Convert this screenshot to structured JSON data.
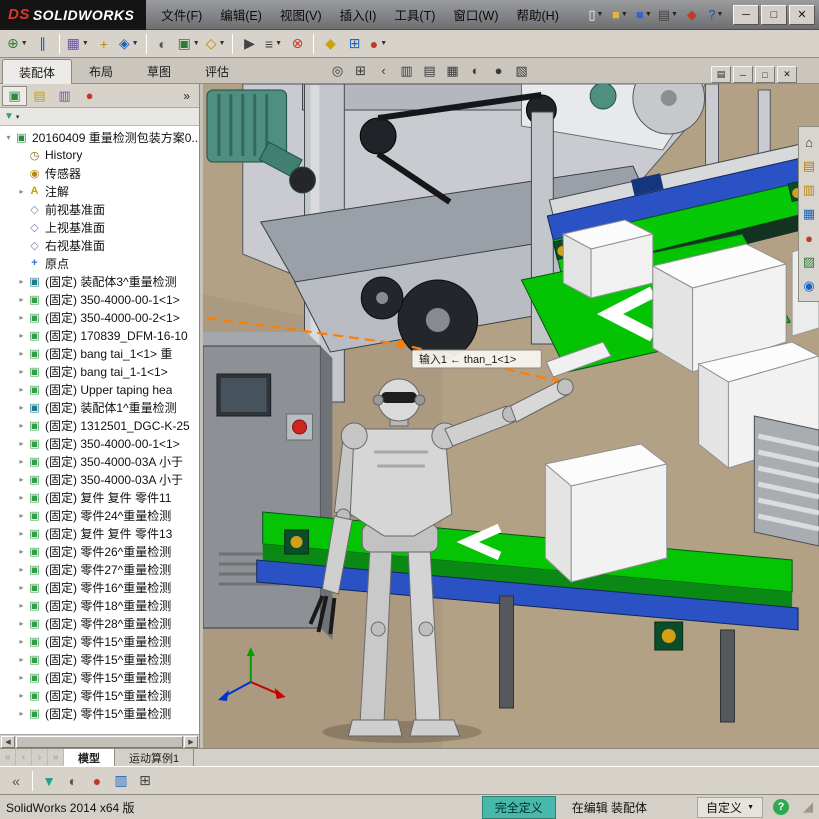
{
  "titlebar": {
    "logo_prefix": "DS",
    "logo": "SOLIDWORKS",
    "menus": [
      {
        "name": "menu-file",
        "label": "文件(F)"
      },
      {
        "name": "menu-edit",
        "label": "编辑(E)"
      },
      {
        "name": "menu-view",
        "label": "视图(V)"
      },
      {
        "name": "menu-insert",
        "label": "插入(I)"
      },
      {
        "name": "menu-tools",
        "label": "工具(T)"
      },
      {
        "name": "menu-window",
        "label": "窗口(W)"
      },
      {
        "name": "menu-help",
        "label": "帮助(H)"
      }
    ],
    "quick_icons": [
      {
        "name": "new-document-icon",
        "glyph": "▯",
        "color": "#f5f5f5",
        "caret": true
      },
      {
        "name": "open-document-icon",
        "glyph": "■",
        "color": "#e6b33c",
        "caret": true
      },
      {
        "name": "save-icon",
        "glyph": "■",
        "color": "#3a63c8",
        "caret": true
      },
      {
        "name": "print-icon",
        "glyph": "▤",
        "color": "#444444",
        "caret": true
      },
      {
        "name": "solidworks-cube-icon",
        "glyph": "◆",
        "color": "#c0392b",
        "caret": false
      },
      {
        "name": "help-icon",
        "glyph": "?",
        "color": "#1b4fa0",
        "caret": true
      }
    ],
    "window_controls": [
      {
        "name": "minimize-button",
        "glyph": "─"
      },
      {
        "name": "maximize-button",
        "glyph": "□"
      },
      {
        "name": "close-button",
        "glyph": "✕"
      }
    ]
  },
  "toolbar": {
    "icons": [
      {
        "name": "insert-components-button",
        "glyph": "⊕",
        "color": "#2e7d32",
        "caret": true
      },
      {
        "name": "mate-button",
        "glyph": "∥",
        "color": "#1565c0",
        "caret": false
      },
      {
        "name": "linear-component-pattern-button",
        "glyph": "▦",
        "color": "#6a4fa0",
        "caret": true,
        "sep": true
      },
      {
        "name": "smart-fasteners-button",
        "glyph": "+",
        "color": "#c28b00",
        "caret": false
      },
      {
        "name": "move-component-button",
        "glyph": "◈",
        "color": "#1565c0",
        "caret": true
      },
      {
        "name": "show-hidden-components-button",
        "glyph": "◐",
        "color": "#555555",
        "caret": false,
        "sep": true
      },
      {
        "name": "assembly-features-button",
        "glyph": "▣",
        "color": "#2e7d32",
        "caret": true
      },
      {
        "name": "reference-geometry-button",
        "glyph": "◇",
        "color": "#b8860b",
        "caret": true
      },
      {
        "name": "new-motion-study-button",
        "glyph": "▶",
        "color": "#444444",
        "caret": false,
        "sep": true
      },
      {
        "name": "bill-of-materials-button",
        "glyph": "≡",
        "color": "#444444",
        "caret": true
      },
      {
        "name": "exploded-view-button",
        "glyph": "⊗",
        "color": "#c0392b",
        "caret": false
      },
      {
        "name": "instant3d-button",
        "glyph": "◆",
        "color": "#caa500",
        "caret": false,
        "sep": true
      },
      {
        "name": "interference-detection-button",
        "glyph": "⊞",
        "color": "#1565c0",
        "caret": false
      },
      {
        "name": "edit-appearance-button",
        "glyph": "●",
        "color": "#c0392b",
        "caret": true
      }
    ]
  },
  "command_tabs": {
    "tabs": [
      {
        "name": "tab-assembly",
        "label": "装配体",
        "active": true
      },
      {
        "name": "tab-layout",
        "label": "布局",
        "active": false
      },
      {
        "name": "tab-sketch",
        "label": "草图",
        "active": false
      },
      {
        "name": "tab-evaluate",
        "label": "评估",
        "active": false
      }
    ]
  },
  "headsup": {
    "icons": [
      {
        "name": "zoom-fit-icon",
        "glyph": "◎"
      },
      {
        "name": "zoom-area-icon",
        "glyph": "⊞"
      },
      {
        "name": "previous-view-icon",
        "glyph": "‹"
      },
      {
        "name": "section-view-icon",
        "glyph": "▥"
      },
      {
        "name": "view-orientation-icon",
        "glyph": "▤"
      },
      {
        "name": "display-style-icon",
        "glyph": "▦"
      },
      {
        "name": "hide-show-items-icon",
        "glyph": "◐"
      },
      {
        "name": "edit-appearance-icon",
        "glyph": "●"
      },
      {
        "name": "apply-scene-icon",
        "glyph": "▧"
      }
    ],
    "doc_controls": [
      {
        "name": "doc-menu-icon",
        "glyph": "▤"
      },
      {
        "name": "doc-minimize-button",
        "glyph": "─"
      },
      {
        "name": "doc-restore-button",
        "glyph": "□"
      },
      {
        "name": "doc-close-button",
        "glyph": "✕"
      }
    ]
  },
  "panel": {
    "manager_tabs": [
      {
        "name": "featuremanager-tab",
        "glyph": "▣",
        "color": "#2b8a3e",
        "active": true
      },
      {
        "name": "propertymanager-tab",
        "glyph": "▤",
        "color": "#c9a200",
        "active": false
      },
      {
        "name": "configurationmanager-tab",
        "glyph": "▥",
        "color": "#7a4fa0",
        "active": false
      },
      {
        "name": "displaymanager-tab",
        "glyph": "●",
        "color": "#c0392b",
        "active": false
      }
    ],
    "overflow": "»",
    "filter": {
      "glyph": "▼",
      "color": "#2b9e8f"
    },
    "tree_icons": {
      "assembly": {
        "glyph": "▣",
        "color": "#2b8a3e"
      },
      "history": {
        "glyph": "◷",
        "color": "#8a6d1a"
      },
      "sensors": {
        "glyph": "◉",
        "color": "#b8860b"
      },
      "annotations": {
        "glyph": "A",
        "color": "#c9a200"
      },
      "plane": {
        "glyph": "◇",
        "color": "#6f87a8"
      },
      "origin": {
        "glyph": "+",
        "color": "#2f6fd0"
      },
      "component": {
        "glyph": "▣",
        "color": "#2f9e44"
      },
      "subassembly": {
        "glyph": "▣",
        "color": "#1f7a8c"
      }
    },
    "tree": {
      "items": [
        {
          "icon": "assembly",
          "expander": "▾",
          "indent": 0,
          "label": "20160409 重量检测包装方案0..."
        },
        {
          "icon": "history",
          "expander": "",
          "indent": 1,
          "label": "History"
        },
        {
          "icon": "sensors",
          "expander": "",
          "indent": 1,
          "label": "传感器"
        },
        {
          "icon": "annotations",
          "expander": "▸",
          "indent": 1,
          "label": "注解"
        },
        {
          "icon": "plane",
          "expander": "",
          "indent": 1,
          "label": "前视基准面"
        },
        {
          "icon": "plane",
          "expander": "",
          "indent": 1,
          "label": "上视基准面"
        },
        {
          "icon": "plane",
          "expander": "",
          "indent": 1,
          "label": "右视基准面"
        },
        {
          "icon": "origin",
          "expander": "",
          "indent": 1,
          "label": "原点"
        },
        {
          "icon": "subassembly",
          "expander": "▸",
          "indent": 1,
          "label": "(固定) 装配体3^重量检测"
        },
        {
          "icon": "component",
          "expander": "▸",
          "indent": 1,
          "label": "(固定) 350-4000-00-1<1>"
        },
        {
          "icon": "component",
          "expander": "▸",
          "indent": 1,
          "label": "(固定) 350-4000-00-2<1>"
        },
        {
          "icon": "component",
          "expander": "▸",
          "indent": 1,
          "label": "(固定) 170839_DFM-16-10"
        },
        {
          "icon": "component",
          "expander": "▸",
          "indent": 1,
          "label": "(固定) bang tai_1<1> 重"
        },
        {
          "icon": "component",
          "expander": "▸",
          "indent": 1,
          "label": "(固定) bang tai_1-1<1>"
        },
        {
          "icon": "component",
          "expander": "▸",
          "indent": 1,
          "label": "(固定) Upper taping hea"
        },
        {
          "icon": "subassembly",
          "expander": "▸",
          "indent": 1,
          "label": "(固定) 装配体1^重量检测"
        },
        {
          "icon": "component",
          "expander": "▸",
          "indent": 1,
          "label": "(固定) 1312501_DGC-K-25"
        },
        {
          "icon": "component",
          "expander": "▸",
          "indent": 1,
          "label": "(固定) 350-4000-00-1<1>"
        },
        {
          "icon": "component",
          "expander": "▸",
          "indent": 1,
          "label": "(固定) 350-4000-03A 小于"
        },
        {
          "icon": "component",
          "expander": "▸",
          "indent": 1,
          "label": "(固定) 350-4000-03A 小于"
        },
        {
          "icon": "component",
          "expander": "▸",
          "indent": 1,
          "label": "(固定) 复件 复件 零件11"
        },
        {
          "icon": "component",
          "expander": "▸",
          "indent": 1,
          "label": "(固定) 零件24^重量检测"
        },
        {
          "icon": "component",
          "expander": "▸",
          "indent": 1,
          "label": "(固定) 复件 复件 零件13"
        },
        {
          "icon": "component",
          "expander": "▸",
          "indent": 1,
          "label": "(固定) 零件26^重量检测"
        },
        {
          "icon": "component",
          "expander": "▸",
          "indent": 1,
          "label": "(固定) 零件27^重量检测"
        },
        {
          "icon": "component",
          "expander": "▸",
          "indent": 1,
          "label": "(固定) 零件16^重量检测"
        },
        {
          "icon": "component",
          "expander": "▸",
          "indent": 1,
          "label": "(固定) 零件18^重量检测"
        },
        {
          "icon": "component",
          "expander": "▸",
          "indent": 1,
          "label": "(固定) 零件28^重量检测"
        },
        {
          "icon": "component",
          "expander": "▸",
          "indent": 1,
          "label": "(固定) 零件15^重量检测"
        },
        {
          "icon": "component",
          "expander": "▸",
          "indent": 1,
          "label": "(固定) 零件15^重量检测"
        },
        {
          "icon": "component",
          "expander": "▸",
          "indent": 1,
          "label": "(固定) 零件15^重量检测"
        },
        {
          "icon": "component",
          "expander": "▸",
          "indent": 1,
          "label": "(固定) 零件15^重量检测"
        },
        {
          "icon": "component",
          "expander": "▸",
          "indent": 1,
          "label": "(固定) 零件15^重量检测"
        }
      ]
    }
  },
  "viewport": {
    "callout": "输入1 ← than_1<1>",
    "taskpane_icons": [
      {
        "name": "home-icon",
        "glyph": "⌂",
        "color": "#333333"
      },
      {
        "name": "design-library-icon",
        "glyph": "▤",
        "color": "#c07b00"
      },
      {
        "name": "file-explorer-icon",
        "glyph": "▥",
        "color": "#b8860b"
      },
      {
        "name": "view-palette-icon",
        "glyph": "▦",
        "color": "#1565c0"
      },
      {
        "name": "appearances-scenes-icon",
        "glyph": "●",
        "color": "#c0392b"
      },
      {
        "name": "custom-properties-icon",
        "glyph": "▨",
        "color": "#2e7d32"
      },
      {
        "name": "solidworks-forum-icon",
        "glyph": "◉",
        "color": "#1565c0"
      }
    ],
    "colors": {
      "floor_tan": "#b3a186",
      "belt_green": "#04c404",
      "frame_blue": "#2a52c4",
      "machine_gray": "#c3c6cb",
      "robot_gray": "#d6d6d6",
      "mate_orange": "#ff7d00"
    }
  },
  "bottom": {
    "nav_icons": [
      {
        "name": "first-tab-button",
        "glyph": "«"
      },
      {
        "name": "prev-tab-button",
        "glyph": "‹"
      },
      {
        "name": "next-tab-button",
        "glyph": "›"
      },
      {
        "name": "last-tab-button",
        "glyph": "»"
      }
    ],
    "model_tabs": [
      {
        "name": "tab-model",
        "label": "模型",
        "active": true
      },
      {
        "name": "tab-motion-study",
        "label": "运动算例1",
        "active": false
      }
    ],
    "toolbar_icons": [
      {
        "name": "collapse-button",
        "glyph": "«",
        "color": "#555555"
      },
      {
        "name": "filter-toggle-icon",
        "glyph": "▼",
        "color": "#2b9e8f"
      },
      {
        "name": "hide-types-icon",
        "glyph": "◐",
        "color": "#555555"
      },
      {
        "name": "edit-color-icon",
        "glyph": "●",
        "color": "#c0392b"
      },
      {
        "name": "section-icon",
        "glyph": "▥",
        "color": "#1565c0"
      },
      {
        "name": "grid-icon",
        "glyph": "⊞",
        "color": "#444444"
      }
    ]
  },
  "statusbar": {
    "left": "SolidWorks 2014 x64 版",
    "fully_defined": "完全定义",
    "editing": "在编辑 装配体",
    "custom": "自定义",
    "help_glyph": "?"
  }
}
